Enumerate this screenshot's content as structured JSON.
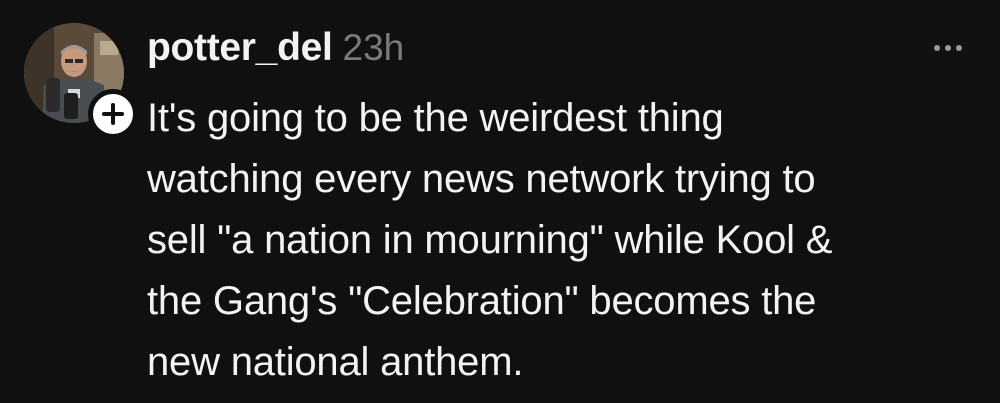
{
  "post": {
    "username": "potter_del",
    "timestamp": "23h",
    "text_lines": [
      "It's going to be the weirdest thing",
      "watching every news network trying to",
      "sell \"a nation in mourning\" while Kool &",
      "the Gang's \"Celebration\" becomes the",
      "new national anthem."
    ]
  },
  "icons": {
    "follow": "plus-icon",
    "more": "more-horizontal-icon"
  },
  "colors": {
    "background": "#101010",
    "text": "#f3f3f3",
    "muted": "#7a7a7a"
  }
}
